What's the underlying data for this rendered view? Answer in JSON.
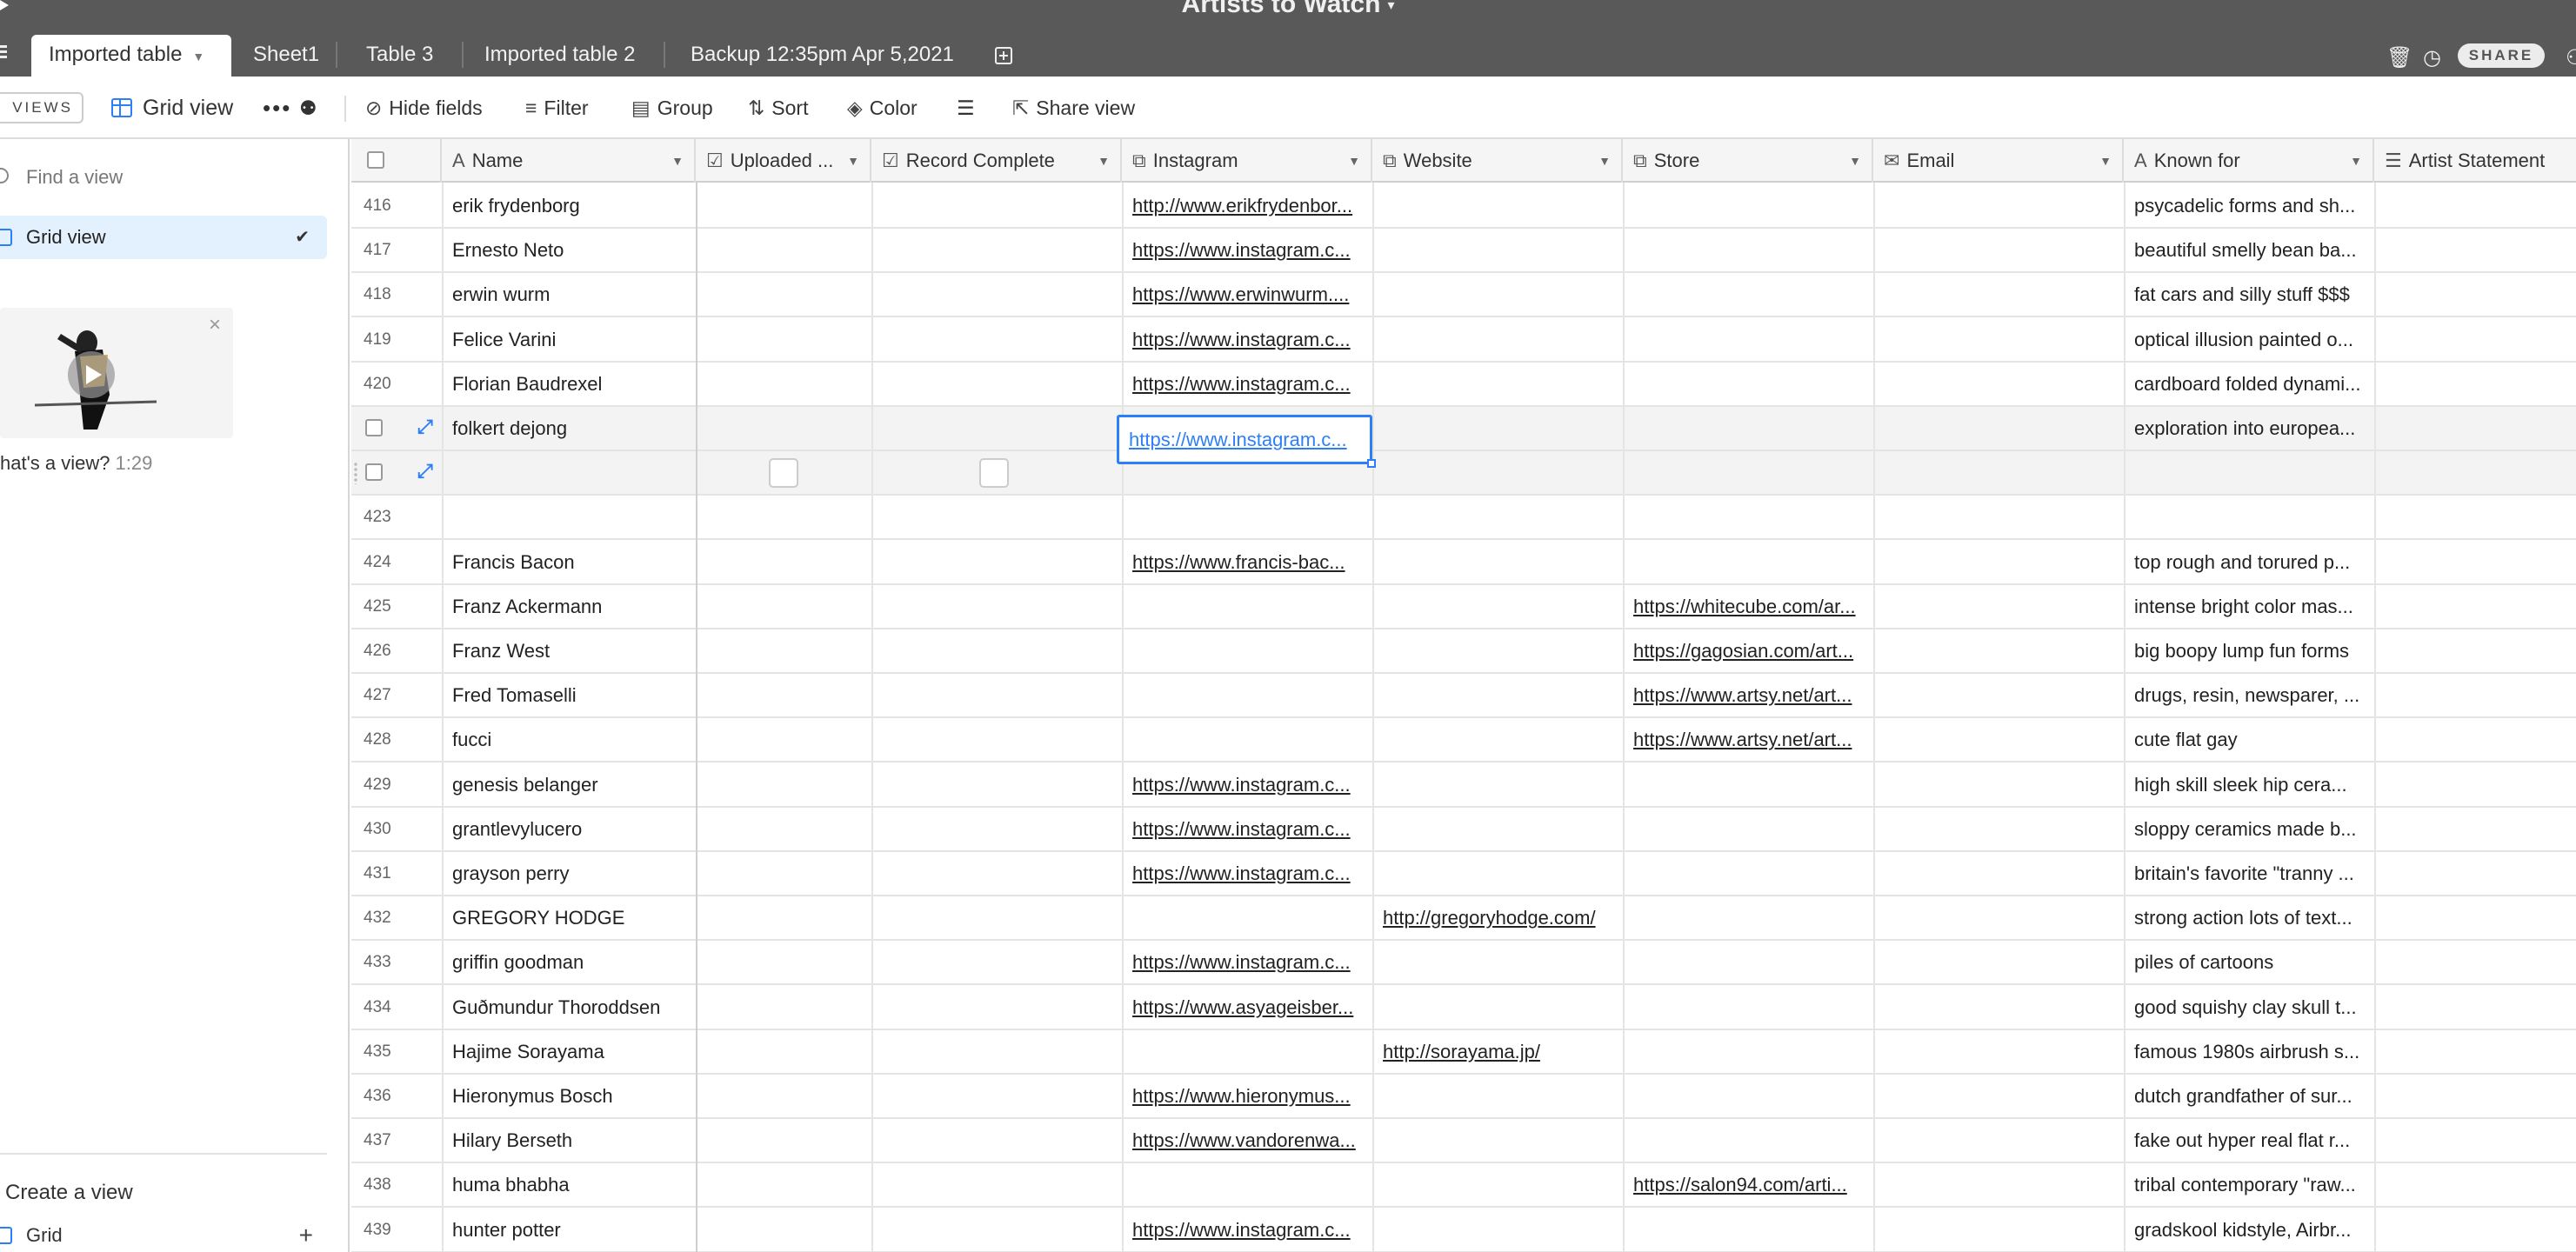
{
  "app": {
    "base_title": "Artists to Watch",
    "share_label": "SHARE"
  },
  "tabs": [
    "Imported table",
    "Sheet1",
    "Table 3",
    "Imported table 2",
    "Backup 12:35pm Apr 5,2021"
  ],
  "toolbar": {
    "views_label": "VIEWS",
    "view_name": "Grid view",
    "hide_fields": "Hide fields",
    "filter": "Filter",
    "group": "Group",
    "sort": "Sort",
    "color": "Color",
    "share_view": "Share view"
  },
  "sidebar": {
    "find_placeholder": "Find a view",
    "active_view": "Grid view",
    "video_caption": "hat's a view?",
    "video_duration": "1:29",
    "create_view": "Create a view",
    "create_grid": "Grid"
  },
  "columns": [
    "Name",
    "Uploaded ...",
    "Record Complete",
    "Instagram",
    "Website",
    "Store",
    "Email",
    "Known for",
    "Artist Statement"
  ],
  "rows": [
    {
      "num": "416",
      "name": "erik frydenborg",
      "instagram": "http://www.erikfrydenbor...",
      "website": "",
      "store": "",
      "known": "psycadelic forms and sh..."
    },
    {
      "num": "417",
      "name": "Ernesto Neto",
      "instagram": "https://www.instagram.c...",
      "website": "",
      "store": "",
      "known": "beautiful smelly bean ba..."
    },
    {
      "num": "418",
      "name": "erwin wurm",
      "instagram": "https://www.erwinwurm....",
      "website": "",
      "store": "",
      "known": "fat cars and silly stuff $$$"
    },
    {
      "num": "419",
      "name": "Felice Varini",
      "instagram": "https://www.instagram.c...",
      "website": "",
      "store": "",
      "known": "optical illusion painted o..."
    },
    {
      "num": "420",
      "name": "Florian Baudrexel",
      "instagram": "https://www.instagram.c...",
      "website": "",
      "store": "",
      "known": "cardboard folded dynami..."
    },
    {
      "num": "",
      "name": "folkert dejong",
      "instagram": "https://www.instagram.c...",
      "website": "",
      "store": "",
      "known": "exploration into europea...",
      "selected": true
    },
    {
      "num": "",
      "name": "",
      "instagram": "",
      "website": "",
      "store": "",
      "known": "",
      "blank": true
    },
    {
      "num": "423",
      "name": "",
      "instagram": "",
      "website": "",
      "store": "",
      "known": ""
    },
    {
      "num": "424",
      "name": "Francis Bacon",
      "instagram": "https://www.francis-bac...",
      "website": "",
      "store": "",
      "known": "top rough and torured p..."
    },
    {
      "num": "425",
      "name": "Franz Ackermann",
      "instagram": "",
      "website": "",
      "store": "https://whitecube.com/ar...",
      "known": "intense bright color mas..."
    },
    {
      "num": "426",
      "name": "Franz West",
      "instagram": "",
      "website": "",
      "store": "https://gagosian.com/art...",
      "known": "big boopy lump fun forms"
    },
    {
      "num": "427",
      "name": "Fred Tomaselli",
      "instagram": "",
      "website": "",
      "store": "https://www.artsy.net/art...",
      "known": "drugs, resin, newsparer, ..."
    },
    {
      "num": "428",
      "name": "fucci",
      "instagram": "",
      "website": "",
      "store": "https://www.artsy.net/art...",
      "known": "cute flat gay"
    },
    {
      "num": "429",
      "name": "genesis belanger",
      "instagram": "https://www.instagram.c...",
      "website": "",
      "store": "",
      "known": "high skill sleek hip cera..."
    },
    {
      "num": "430",
      "name": "grantlevylucero",
      "instagram": "https://www.instagram.c...",
      "website": "",
      "store": "",
      "known": "sloppy ceramics made b..."
    },
    {
      "num": "431",
      "name": "grayson perry",
      "instagram": "https://www.instagram.c...",
      "website": "",
      "store": "",
      "known": "britain's favorite \"tranny ..."
    },
    {
      "num": "432",
      "name": "GREGORY HODGE",
      "instagram": "",
      "website": "http://gregoryhodge.com/",
      "store": "",
      "known": "strong action lots of text..."
    },
    {
      "num": "433",
      "name": "griffin goodman",
      "instagram": "https://www.instagram.c...",
      "website": "",
      "store": "",
      "known": "piles of cartoons"
    },
    {
      "num": "434",
      "name": "Guðmundur Thoroddsen",
      "instagram": "https://www.asyageisber...",
      "website": "",
      "store": "",
      "known": "good squishy clay skull t..."
    },
    {
      "num": "435",
      "name": "Hajime Sorayama",
      "instagram": "",
      "website": "http://sorayama.jp/",
      "store": "",
      "known": "famous 1980s airbrush s..."
    },
    {
      "num": "436",
      "name": "Hieronymus Bosch",
      "instagram": "https://www.hieronymus...",
      "website": "",
      "store": "",
      "known": "dutch grandfather of sur..."
    },
    {
      "num": "437",
      "name": "Hilary Berseth",
      "instagram": "https://www.vandorenwa...",
      "website": "",
      "store": "",
      "known": "fake out hyper real flat r..."
    },
    {
      "num": "438",
      "name": "huma bhabha",
      "instagram": "",
      "website": "",
      "store": "https://salon94.com/arti...",
      "known": "tribal contemporary \"raw..."
    },
    {
      "num": "439",
      "name": "hunter potter",
      "instagram": "https://www.instagram.c...",
      "website": "",
      "store": "",
      "known": "gradskool kidstyle, Airbr..."
    }
  ]
}
